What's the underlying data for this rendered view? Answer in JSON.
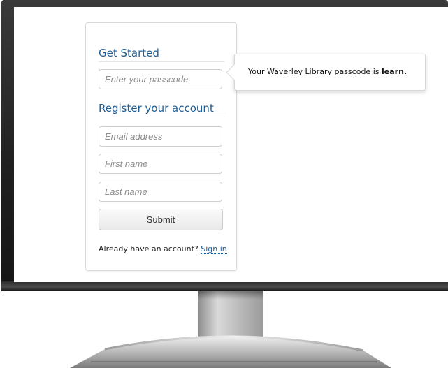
{
  "form": {
    "get_started_title": "Get Started",
    "passcode_placeholder": "Enter your passcode",
    "register_title": "Register your account",
    "email_placeholder": "Email address",
    "first_name_placeholder": "First name",
    "last_name_placeholder": "Last name",
    "submit_label": "Submit",
    "signin_prompt": "Already have an account?",
    "signin_link": "Sign in"
  },
  "tooltip": {
    "text_prefix": "Your Waverley Library passcode is ",
    "passcode": "learn",
    "text_suffix": "."
  },
  "colors": {
    "heading": "#1f5d95",
    "link": "#1f5d95",
    "bezel": "#1f1f1f"
  }
}
